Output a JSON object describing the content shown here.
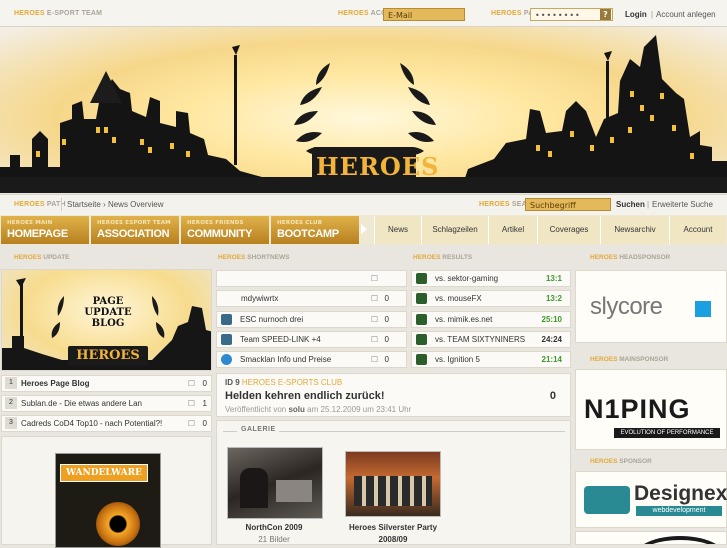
{
  "topbar": {
    "brand_prefix": "HEROES",
    "brand_rest": "E-SPORT TEAM",
    "access_prefix": "HEROES",
    "access_rest": "ACCESS",
    "email_value": "E-Mail",
    "pass_prefix": "HEROES",
    "pass_rest": "PASS",
    "pass_value": "••••••••",
    "help_label": "?",
    "login_label": "Login",
    "signup_label": "Account anlegen"
  },
  "banner": {
    "logo_text": "HEROES"
  },
  "path": {
    "prefix": "HEROES",
    "rest": "PATH",
    "crumb_home": "Startseite",
    "crumb_sep": "›",
    "crumb_current": "News Overview",
    "search_prefix": "HEROES",
    "search_rest": "SEARCH",
    "search_value": "Suchbegriff",
    "search_button": "Suchen",
    "advanced_search": "Erweiterte Suche"
  },
  "nav": {
    "main": [
      {
        "sub": "HEROES MAIN",
        "label": "HOMEPAGE"
      },
      {
        "sub": "HEROES ESPORT TEAM",
        "label": "ASSOCIATION"
      },
      {
        "sub": "HEROES FRIENDS",
        "label": "COMMUNITY"
      },
      {
        "sub": "HEROES CLUB",
        "label": "BOOTCAMP"
      }
    ],
    "secondary": [
      "News",
      "Schlagzeilen",
      "Artikel",
      "Coverages",
      "Newsarchiv",
      "Account"
    ]
  },
  "sections": {
    "update": {
      "prefix": "HEROES",
      "rest": "UPDATE"
    },
    "shortnews": {
      "prefix": "HEROES",
      "rest": "SHORTNEWS"
    },
    "results": {
      "prefix": "HEROES",
      "rest": "RESULTS"
    },
    "headsponsor": {
      "prefix": "HEROES",
      "rest": "HEADSPONSOR"
    },
    "mainsponsor": {
      "prefix": "HEROES",
      "rest": "MAINSPONSOR"
    },
    "sponsor": {
      "prefix": "HEROES",
      "rest": "SPONSOR"
    }
  },
  "update_image": {
    "lines": [
      "PAGE",
      "UPDATE",
      "BLOG"
    ],
    "logo": "HEROES"
  },
  "update_list": [
    {
      "num": "1",
      "title": "Heroes Page Blog",
      "comments": "0"
    },
    {
      "num": "2",
      "title": "Sublan.de - Die etwas andere Lan",
      "comments": "1"
    },
    {
      "num": "3",
      "title": "Cadreds CoD4 Top10 - nach Potential?!",
      "comments": "0"
    }
  ],
  "update_ad": {
    "label": "WANDELWARE"
  },
  "shortnews": [
    {
      "title": "",
      "comments": ""
    },
    {
      "title": "mdywiwrtx",
      "comments": "0"
    },
    {
      "title": "ESC nurnoch drei",
      "comments": "0"
    },
    {
      "title": "Team SPEED-LINK +4",
      "comments": "0"
    },
    {
      "title": "Smacklan Info und Preise",
      "comments": "0"
    }
  ],
  "results": [
    {
      "opponent": "vs. sektor-gaming",
      "score": "13:1",
      "color": "#3d9a2b"
    },
    {
      "opponent": "vs. mouseFX",
      "score": "13:2",
      "color": "#3d9a2b"
    },
    {
      "opponent": "vs. mimik.es.net",
      "score": "25:10",
      "color": "#3d9a2b"
    },
    {
      "opponent": "vs. TEAM SIXTYNINERS",
      "score": "24:24",
      "color": "#333333"
    },
    {
      "opponent": "vs. Ignition 5",
      "score": "21:14",
      "color": "#3d9a2b"
    }
  ],
  "article": {
    "id_label": "ID 9",
    "club": "HEROES E-SPORTS CLUB",
    "title": "Helden kehren endlich zurück!",
    "comments": "0",
    "meta_prefix": "Veröffentlicht von",
    "author": "solu",
    "meta_suffix": "am 25.12.2009 um 23:41 Uhr"
  },
  "gallery": {
    "label": "GALERIE",
    "items": [
      {
        "title": "NorthCon 2009",
        "subtitle": "21 Bilder"
      },
      {
        "title": "Heroes Silverster Party",
        "subtitle": "2008/09"
      }
    ]
  },
  "sponsors": {
    "head": {
      "name": "slycore"
    },
    "main": {
      "name": "N1PING",
      "tagline": "EVOLUTION OF PERFORMANCE"
    },
    "sponsor": {
      "name": "Designex",
      "tagline": "webdevelopment"
    }
  },
  "colors": {
    "accent": "#e2a93a",
    "nav_gold": "#c8902c",
    "win": "#3d9a2b"
  }
}
